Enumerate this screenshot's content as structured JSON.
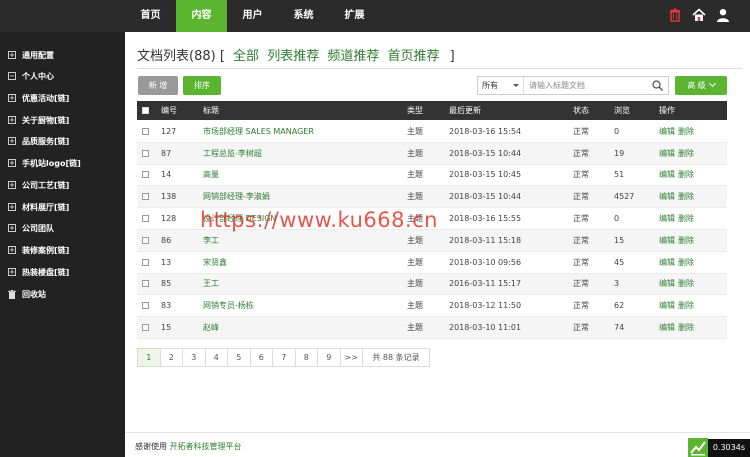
{
  "topnav": {
    "items": [
      {
        "label": "首页"
      },
      {
        "label": "内容",
        "active": true
      },
      {
        "label": "用户"
      },
      {
        "label": "系统"
      },
      {
        "label": "扩展"
      }
    ],
    "icons": [
      "trash-icon",
      "home-icon",
      "user-icon"
    ]
  },
  "sidebar": {
    "items": [
      {
        "label": "通用配置",
        "icon": "plus-box-icon"
      },
      {
        "label": "个人中心",
        "icon": "minus-box-icon"
      },
      {
        "label": "优惠活动[链]",
        "icon": "plus-box-icon"
      },
      {
        "label": "关于厨物[链]",
        "icon": "plus-box-icon"
      },
      {
        "label": "品质服务[链]",
        "icon": "plus-box-icon"
      },
      {
        "label": "手机站logo[链]",
        "icon": "plus-box-icon"
      },
      {
        "label": "公司工艺[链]",
        "icon": "plus-box-icon"
      },
      {
        "label": "材料展厅[链]",
        "icon": "plus-box-icon"
      },
      {
        "label": "公司团队",
        "icon": "plus-box-icon"
      },
      {
        "label": "装修案例[链]",
        "icon": "plus-box-icon"
      },
      {
        "label": "热装楼盘[链]",
        "icon": "plus-box-icon"
      },
      {
        "label": "回收站",
        "icon": "trash-icon"
      }
    ]
  },
  "main": {
    "title": "文档列表(88)",
    "bracket_open": "[",
    "bracket_close": "]",
    "links": [
      "全部",
      "列表推荐",
      "频道推荐",
      "首页推荐"
    ]
  },
  "toolbar": {
    "new_label": "新 增",
    "sort_label": "排序",
    "filter_selected": "所有",
    "search_placeholder": "请输入标题文档",
    "advanced_label": "高 级"
  },
  "table": {
    "headers": {
      "id": "编号",
      "title": "标题",
      "type": "类型",
      "updated": "最后更新",
      "status": "状态",
      "views": "浏览",
      "ops": "操作"
    },
    "rows": [
      {
        "id": "127",
        "title": "市场部经理 SALES MANAGER",
        "type": "主题",
        "updated": "2018-03-16 15:54",
        "status": "正常",
        "views": "0",
        "edit": "编辑",
        "del": "删除"
      },
      {
        "id": "87",
        "title": "工程总监-李树超",
        "type": "主题",
        "updated": "2018-03-15 10:44",
        "status": "正常",
        "views": "19",
        "edit": "编辑",
        "del": "删除"
      },
      {
        "id": "14",
        "title": "高量",
        "type": "主题",
        "updated": "2018-03-15 10:45",
        "status": "正常",
        "views": "51",
        "edit": "编辑",
        "del": "删除"
      },
      {
        "id": "138",
        "title": "网销部经理-李淑娟",
        "type": "主题",
        "updated": "2018-03-15 10:44",
        "status": "正常",
        "views": "4527",
        "edit": "编辑",
        "del": "删除"
      },
      {
        "id": "128",
        "title": "设计部经理 DESIGN",
        "type": "主题",
        "updated": "2018-03-16 15:55",
        "status": "正常",
        "views": "0",
        "edit": "编辑",
        "del": "删除"
      },
      {
        "id": "86",
        "title": "李工",
        "type": "主题",
        "updated": "2018-03-11 15:18",
        "status": "正常",
        "views": "15",
        "edit": "编辑",
        "del": "删除"
      },
      {
        "id": "13",
        "title": "宋贤鑫",
        "type": "主题",
        "updated": "2018-03-10 09:56",
        "status": "正常",
        "views": "45",
        "edit": "编辑",
        "del": "删除"
      },
      {
        "id": "85",
        "title": "王工",
        "type": "主题",
        "updated": "2016-03-11 15:17",
        "status": "正常",
        "views": "3",
        "edit": "编辑",
        "del": "删除"
      },
      {
        "id": "83",
        "title": "网销专员-杨栋",
        "type": "主题",
        "updated": "2018-03-12 11:50",
        "status": "正常",
        "views": "62",
        "edit": "编辑",
        "del": "删除"
      },
      {
        "id": "15",
        "title": "赵峰",
        "type": "主题",
        "updated": "2018-03-10 11:01",
        "status": "正常",
        "views": "74",
        "edit": "编辑",
        "del": "删除"
      }
    ]
  },
  "pager": {
    "pages": [
      "1",
      "2",
      "3",
      "4",
      "5",
      "6",
      "7",
      "8",
      "9",
      ">>"
    ],
    "current": "1",
    "total_text": "共 88 条记录"
  },
  "footer": {
    "prefix": "感谢使用",
    "link": "开拓者科技管理平台",
    "timer": "0.3034s"
  },
  "watermark": "https://www.ku668.cn",
  "colors": {
    "accent": "#5cb531",
    "link": "#2e7d32",
    "topbar": "#2b2b2b",
    "sidebar": "#222222"
  }
}
